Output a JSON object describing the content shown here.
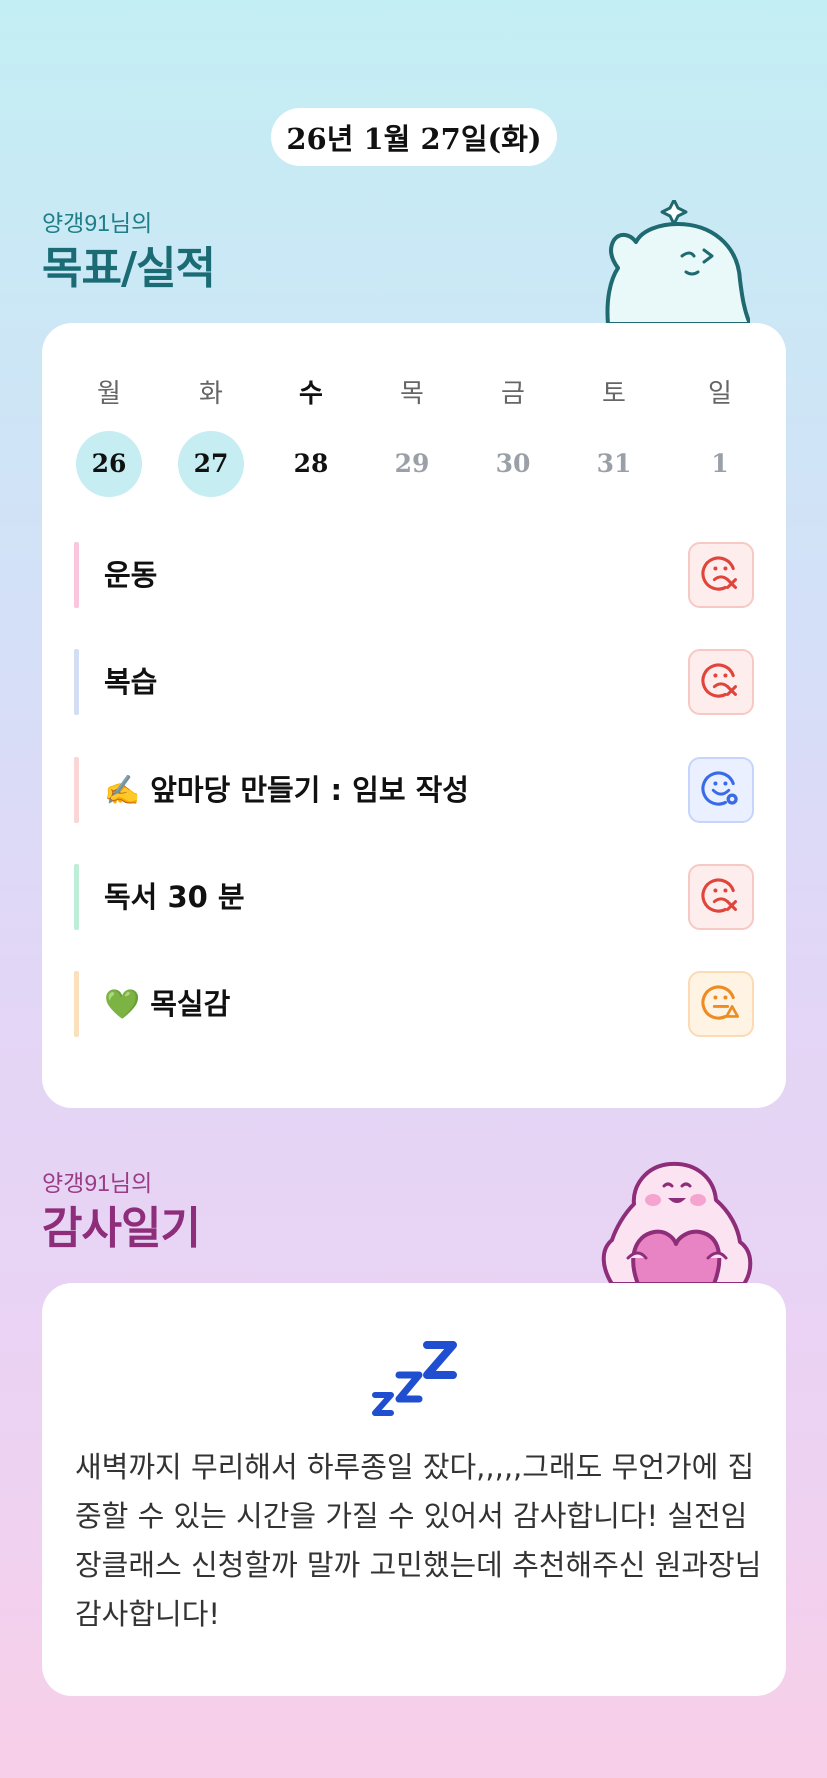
{
  "date_pill": "26년 1월 27일(화)",
  "goals_section": {
    "subtitle": "양갱91님의",
    "title": "목표/실적"
  },
  "week": [
    {
      "dow": "월",
      "day": "26",
      "state": "done"
    },
    {
      "dow": "화",
      "day": "27",
      "state": "done"
    },
    {
      "dow": "수",
      "day": "28",
      "state": "today"
    },
    {
      "dow": "목",
      "day": "29",
      "state": "future"
    },
    {
      "dow": "금",
      "day": "30",
      "state": "future"
    },
    {
      "dow": "토",
      "day": "31",
      "state": "future"
    },
    {
      "dow": "일",
      "day": "1",
      "state": "future"
    }
  ],
  "goals": [
    {
      "label": "운동",
      "bar_color": "#f9c6de",
      "status": "fail",
      "status_icon": "sad-x-icon"
    },
    {
      "label": "복습",
      "bar_color": "#d3ddf3",
      "status": "fail",
      "status_icon": "sad-x-icon"
    },
    {
      "label": "✍️ 앞마당 만들기 : 임보 작성",
      "bar_color": "#fbd6d6",
      "status": "done",
      "status_icon": "smile-o-icon"
    },
    {
      "label": "독서 30 분",
      "bar_color": "#bfeed8",
      "status": "fail",
      "status_icon": "sad-x-icon"
    },
    {
      "label": "💚 목실감",
      "bar_color": "#fbe0bd",
      "status": "partial",
      "status_icon": "neutral-triangle-icon"
    }
  ],
  "thanks_section": {
    "subtitle": "양갱91님의",
    "title": "감사일기"
  },
  "diary": {
    "icon": "zzz-icon",
    "text": "새벽까지 무리해서 하루종일 잤다,,,,,그래도 무언가에 집중할 수 있는 시간을 가질 수 있어서 감사합니다! 실전임장클래스 신청할까 말까 고민했는데 추천해주신 원과장님 감사합니다!"
  },
  "colors": {
    "fail": "#e0443a",
    "done": "#3a6be6",
    "partial": "#ec8c23",
    "goal_title": "#1a6b74",
    "thanks_title": "#8e2d79"
  }
}
